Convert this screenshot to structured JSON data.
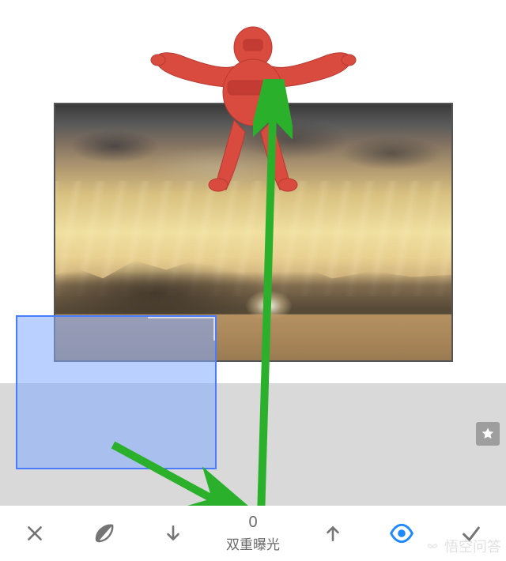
{
  "editor": {
    "tool_name": "双重曝光",
    "slider_value": "0",
    "overlay_subject": "skydiver",
    "overlay_tint": "#d94a3f"
  },
  "toolbar": {
    "cancel_icon": "close-icon",
    "style_icon": "leaf-contrast-icon",
    "move_down_icon": "arrow-down-icon",
    "move_up_icon": "arrow-up-icon",
    "visibility_icon": "eye-icon",
    "confirm_icon": "check-icon"
  },
  "colors": {
    "selection_border": "#4a7cff",
    "selection_fill": "rgba(130,170,255,0.55)",
    "annotation_arrow": "#2bb02b",
    "eye_accent": "#1e88ff",
    "toolbar_icon": "#757575"
  },
  "annotations": {
    "arrow1": {
      "from": "overlay-thumb",
      "to": "tool-label"
    },
    "arrow2": {
      "from": "tool-label",
      "to": "skydiver-overlay"
    }
  },
  "watermark": {
    "text": "悟空问答"
  }
}
